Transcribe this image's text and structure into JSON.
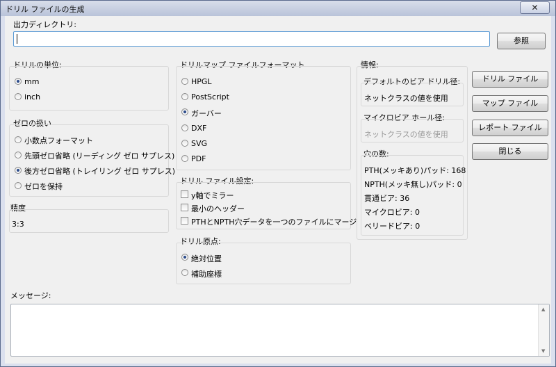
{
  "window": {
    "title": "ドリル ファイルの生成",
    "close_symbol": "✕"
  },
  "output_dir": {
    "label": "出力ディレクトリ:",
    "value": "",
    "browse_label": "参照"
  },
  "drill_units": {
    "label": "ドリルの単位:",
    "options": [
      "mm",
      "inch"
    ],
    "selected": "mm"
  },
  "zeros": {
    "label": "ゼロの扱い",
    "options": [
      "小数点フォーマット",
      "先頭ゼロ省略 (リーディング ゼロ サプレス)",
      "後方ゼロ省略 (トレイリング ゼロ サプレス)",
      "ゼロを保持"
    ],
    "selected": "後方ゼロ省略 (トレイリング ゼロ サプレス)"
  },
  "precision": {
    "label": "精度",
    "value": "3:3"
  },
  "map_format": {
    "label": "ドリルマップ ファイルフォーマット",
    "options": [
      "HPGL",
      "PostScript",
      "ガーバー",
      "DXF",
      "SVG",
      "PDF"
    ],
    "selected": "ガーバー"
  },
  "drill_settings": {
    "label": "ドリル ファイル設定:",
    "options": [
      {
        "label": "y軸でミラー",
        "checked": false
      },
      {
        "label": "最小のヘッダー",
        "checked": false
      },
      {
        "label": "PTHとNPTH穴データを一つのファイルにマージ",
        "checked": false
      }
    ]
  },
  "drill_origin": {
    "label": "ドリル原点:",
    "options": [
      "絶対位置",
      "補助座標"
    ],
    "selected": "絶対位置"
  },
  "info": {
    "label": "情報:",
    "default_via_label": "デフォルトのビア ドリル径:",
    "default_via_value": "ネットクラスの値を使用",
    "micro_via_label": "マイクロビア ホール径:",
    "micro_via_value": "ネットクラスの値を使用",
    "holes_label": "穴の数:",
    "holes": [
      "PTH(メッキあり)パッド: 168",
      "NPTH(メッキ無し)パッド: 0",
      "貫通ビア: 36",
      "マイクロビア: 0",
      "ベリードビア: 0"
    ]
  },
  "actions": {
    "drill_file": "ドリル ファイル",
    "map_file": "マップ ファイル",
    "report_file": "レポート ファイル",
    "close": "閉じる"
  },
  "messages": {
    "label": "メッセージ:",
    "scroll_up": "▲",
    "scroll_down": "▼"
  }
}
